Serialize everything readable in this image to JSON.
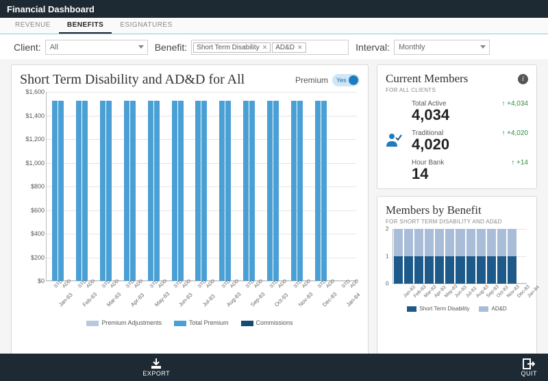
{
  "header": {
    "title": "Financial Dashboard"
  },
  "tabs": [
    {
      "label": "REVENUE",
      "active": false
    },
    {
      "label": "BENEFITS",
      "active": true
    },
    {
      "label": "ESIGNATURES",
      "active": false
    }
  ],
  "filters": {
    "client_label": "Client:",
    "client_value": "All",
    "benefit_label": "Benefit:",
    "benefit_chips": [
      "Short Term Disability",
      "AD&D"
    ],
    "interval_label": "Interval:",
    "interval_value": "Monthly"
  },
  "main_card": {
    "title": "Short Term Disability and AD&D for All",
    "toggle_label": "Premium",
    "toggle_text": "Yes",
    "legend": [
      "Premium Adjustments",
      "Total Premium",
      "Commissions"
    ],
    "legend_colors": [
      "#b8c8de",
      "#4aa0d5",
      "#154a72"
    ]
  },
  "chart_data": {
    "type": "bar",
    "title": "Short Term Disability and AD&D for All",
    "ylabel": "",
    "xlabel": "",
    "ylim": [
      0,
      1600
    ],
    "yticks": [
      0,
      200,
      400,
      600,
      800,
      1000,
      1200,
      1400,
      1600
    ],
    "ytick_labels": [
      "$0",
      "$200",
      "$400",
      "$600",
      "$800",
      "$1,000",
      "$1,200",
      "$1,400",
      "$1,600"
    ],
    "categories": [
      "Jan-83",
      "Feb-83",
      "Mar-83",
      "Apr-83",
      "May-83",
      "Jun-83",
      "Jul-83",
      "Aug-83",
      "Sep-83",
      "Oct-83",
      "Nov-83",
      "Dec-83",
      "Jan-84"
    ],
    "sub_categories": [
      "STD",
      "ADD"
    ],
    "series": [
      {
        "name": "Total Premium",
        "color": "#4aa0d5",
        "values_std": [
          1525,
          1525,
          1525,
          1525,
          1525,
          1525,
          1525,
          1525,
          1525,
          1525,
          1525,
          1525,
          0
        ],
        "values_add": [
          1525,
          1525,
          1525,
          1525,
          1525,
          1525,
          1525,
          1525,
          1525,
          1525,
          1525,
          1525,
          0
        ]
      }
    ]
  },
  "members_card": {
    "title": "Current Members",
    "subhead": "FOR ALL CLIENTS",
    "stats": [
      {
        "label": "Total Active",
        "value": "4,034",
        "delta": "↑ +4,034"
      },
      {
        "label": "Traditional",
        "value": "4,020",
        "delta": "↑ +4,020"
      },
      {
        "label": "Hour Bank",
        "value": "14",
        "delta": "↑ +14"
      }
    ]
  },
  "mini_card": {
    "title": "Members by Benefit",
    "subhead": "FOR SHORT TERM DISABILITY AND AD&D",
    "legend": [
      "Short Term Disability",
      "AD&D"
    ],
    "legend_colors": [
      "#1d5a8a",
      "#a9bdd9"
    ]
  },
  "chart_data_mini": {
    "type": "bar",
    "stacked": true,
    "ylim": [
      0,
      2
    ],
    "yticks": [
      0,
      1,
      2
    ],
    "categories": [
      "Jan-83",
      "Feb-83",
      "Mar-83",
      "Apr-83",
      "May-83",
      "Jun-83",
      "Jul-83",
      "Aug-83",
      "Sep-83",
      "Oct-83",
      "Nov-83",
      "Dec-83",
      "Jan-84"
    ],
    "series": [
      {
        "name": "Short Term Disability",
        "color": "#1d5a8a",
        "values": [
          1,
          1,
          1,
          1,
          1,
          1,
          1,
          1,
          1,
          1,
          1,
          1,
          0
        ]
      },
      {
        "name": "AD&D",
        "color": "#a9bdd9",
        "values": [
          1,
          1,
          1,
          1,
          1,
          1,
          1,
          1,
          1,
          1,
          1,
          1,
          0
        ]
      }
    ]
  },
  "footer": {
    "export": "EXPORT",
    "quit": "QUIT"
  }
}
